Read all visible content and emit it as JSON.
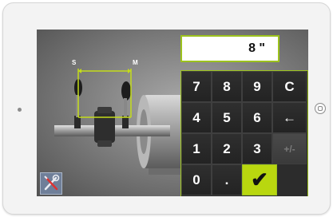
{
  "device": {
    "home_button_icon": "home-button-icon",
    "camera_icon": "front-camera-dot"
  },
  "diagram": {
    "left_marker_label": "S",
    "right_marker_label": "M",
    "accent_color": "#c4dc1a"
  },
  "display": {
    "value": "8 \""
  },
  "keypad": {
    "keys": [
      {
        "label": "7",
        "name": "key-7",
        "enabled": true
      },
      {
        "label": "8",
        "name": "key-8",
        "enabled": true
      },
      {
        "label": "9",
        "name": "key-9",
        "enabled": true
      },
      {
        "label": "C",
        "name": "key-clear",
        "enabled": true
      },
      {
        "label": "4",
        "name": "key-4",
        "enabled": true
      },
      {
        "label": "5",
        "name": "key-5",
        "enabled": true
      },
      {
        "label": "6",
        "name": "key-6",
        "enabled": true
      },
      {
        "label": "←",
        "name": "key-backspace",
        "enabled": true
      },
      {
        "label": "1",
        "name": "key-1",
        "enabled": true
      },
      {
        "label": "2",
        "name": "key-2",
        "enabled": true
      },
      {
        "label": "3",
        "name": "key-3",
        "enabled": true
      },
      {
        "label": "+/-",
        "name": "key-sign",
        "enabled": false
      },
      {
        "label": "0",
        "name": "key-0",
        "enabled": true
      },
      {
        "label": ".",
        "name": "key-decimal",
        "enabled": true
      },
      {
        "label": "✔",
        "name": "confirm-button",
        "enabled": true
      }
    ],
    "confirm_color": "#b9d70f"
  },
  "toolbar": {
    "tools_icon": "wrench-screwdriver-icon"
  }
}
